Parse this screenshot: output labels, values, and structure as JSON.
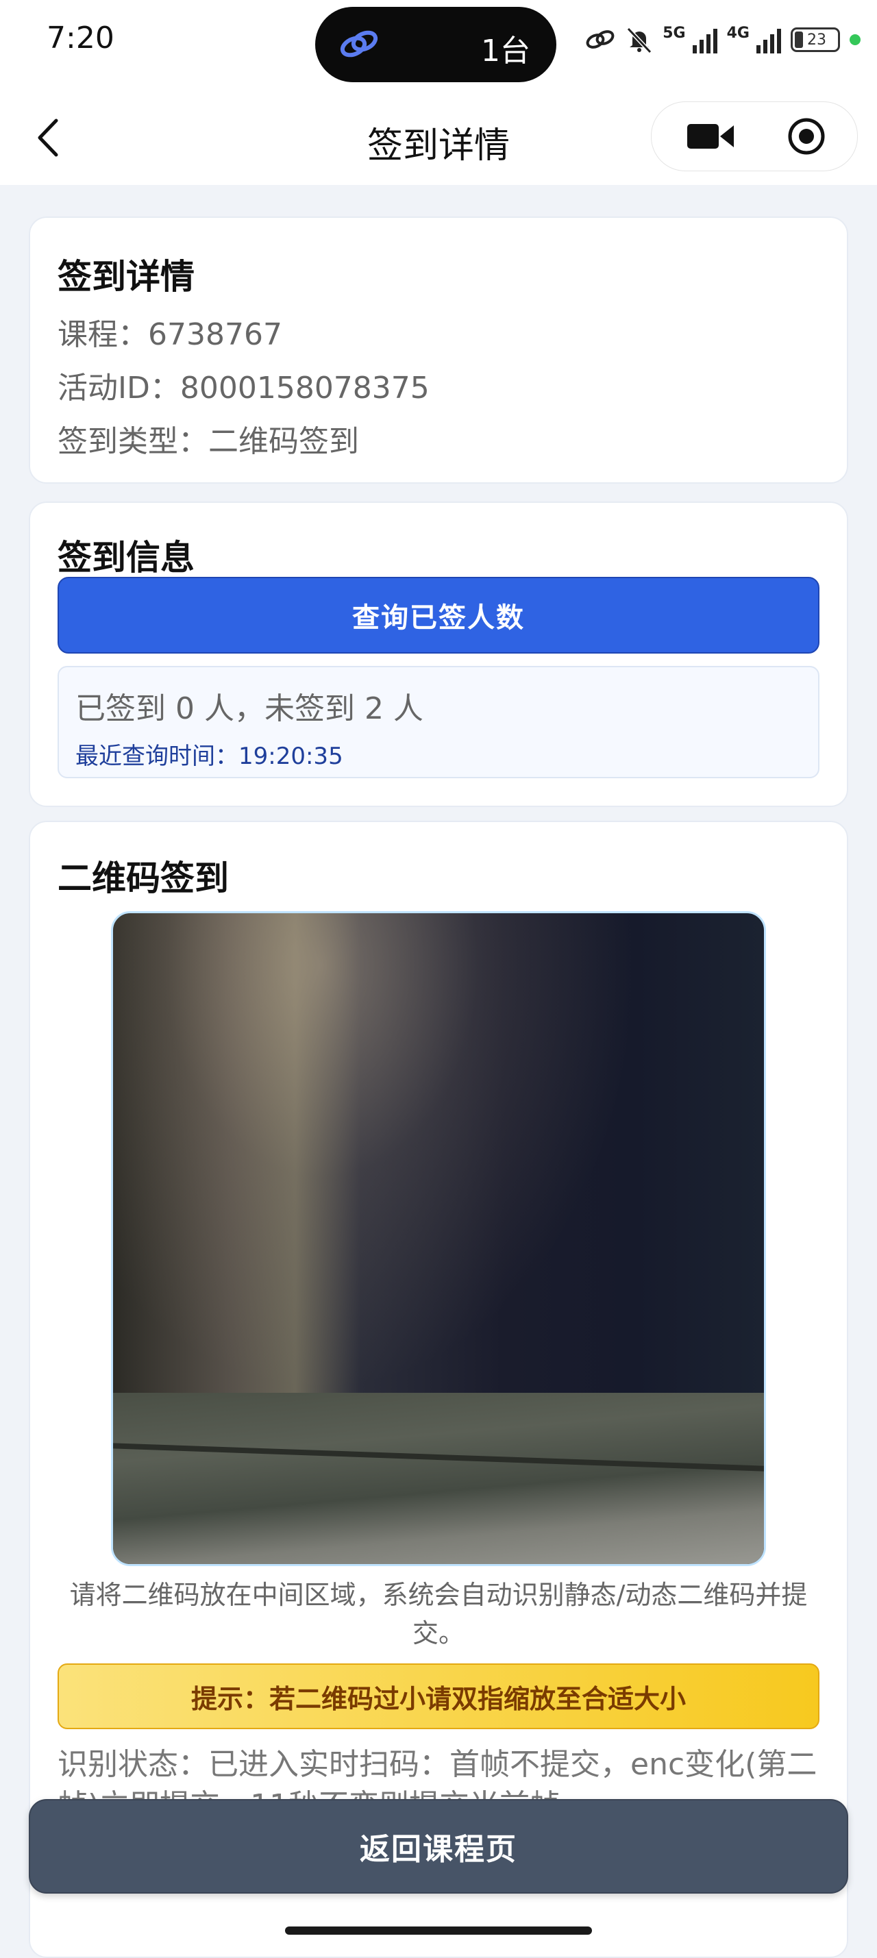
{
  "status_bar": {
    "time": "7:20",
    "island_label": "1台",
    "net_5g": "5G",
    "net_4g": "4G",
    "battery": "23"
  },
  "navbar": {
    "title": "签到详情"
  },
  "details_card": {
    "title": "签到详情",
    "course": "课程：6738767",
    "activity_id": "活动ID：8000158078375",
    "sign_type": "签到类型：二维码签到"
  },
  "info_card": {
    "title": "签到信息",
    "query_button": "查询已签人数",
    "result": "已签到 0 人，未签到 2 人",
    "last_query": "最近查询时间：19:20:35"
  },
  "qr_card": {
    "title": "二维码签到",
    "hint": "请将二维码放在中间区域，系统会自动识别静态/动态二维码并提交。",
    "tip": "提示：若二维码过小请双指缩放至合适大小",
    "status": "识别状态：已进入实时扫码：首帧不提交，enc变化(第二帧)立即提交，11秒不变则提交当前帧"
  },
  "footer": {
    "return_button": "返回课程页"
  },
  "colors": {
    "primary": "#2f63e3",
    "return_button": "#475467",
    "tip_bg": "#f7c91f",
    "page_bg": "#f0f3f8"
  }
}
